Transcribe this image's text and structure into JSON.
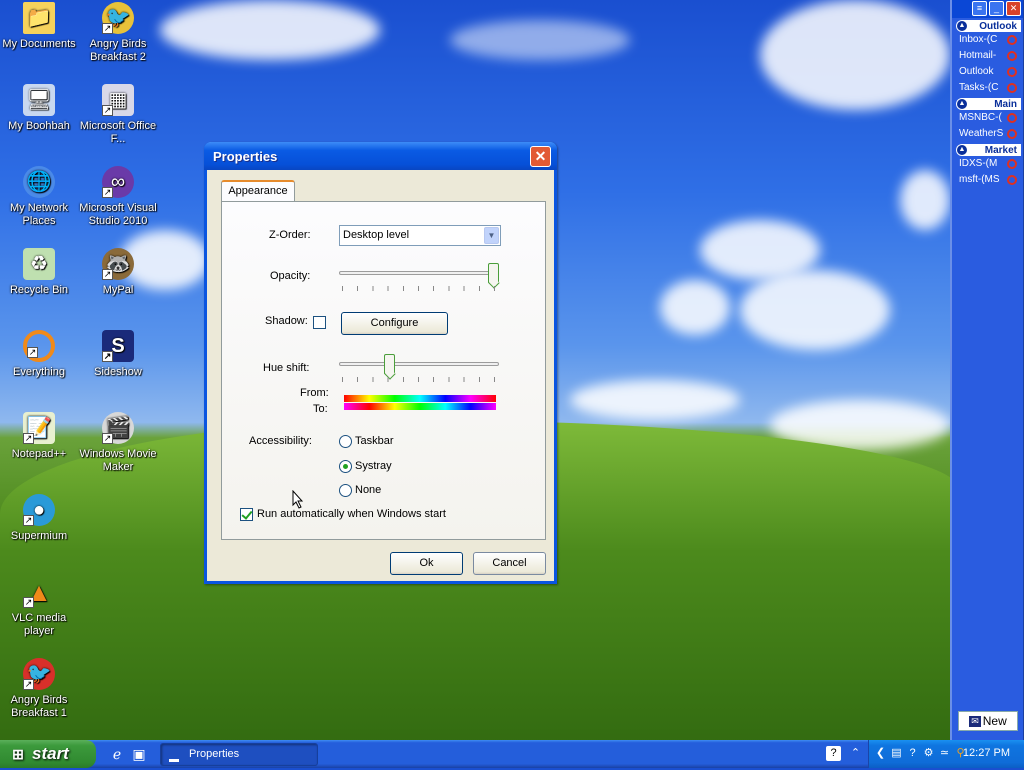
{
  "desktop": {
    "icons": [
      {
        "label": "My Documents",
        "icon": "folder-icon"
      },
      {
        "label": "Angry Birds Breakfast 2",
        "icon": "angry-birds-icon"
      },
      {
        "label": "My Boohbah",
        "icon": "computer-icon"
      },
      {
        "label": "Microsoft Office F...",
        "icon": "office-icon"
      },
      {
        "label": "My Network Places",
        "icon": "network-icon"
      },
      {
        "label": "Microsoft Visual Studio 2010",
        "icon": "visual-studio-icon"
      },
      {
        "label": "Recycle Bin",
        "icon": "recycle-bin-icon"
      },
      {
        "label": "MyPal",
        "icon": "mypal-icon"
      },
      {
        "label": "Everything",
        "icon": "everything-icon"
      },
      {
        "label": "Sideshow",
        "icon": "sideshow-icon"
      },
      {
        "label": "Notepad++",
        "icon": "notepad-icon"
      },
      {
        "label": "Windows Movie Maker",
        "icon": "movie-maker-icon"
      },
      {
        "label": "Supermium",
        "icon": "browser-icon"
      },
      {
        "label": "VLC media player",
        "icon": "vlc-icon"
      },
      {
        "label": "Angry Birds Breakfast 1",
        "icon": "angry-birds-icon"
      }
    ]
  },
  "sidebar": {
    "sections": [
      {
        "title": "Outlook",
        "items": [
          "Inbox-(C",
          "Hotmail-",
          "Outlook",
          "Tasks-(C"
        ]
      },
      {
        "title": "Main",
        "items": [
          "MSNBC-(",
          "WeatherS"
        ]
      },
      {
        "title": "Market",
        "items": [
          "IDXS-(M",
          "msft-(MS"
        ]
      }
    ],
    "new_label": "New"
  },
  "dialog": {
    "title": "Properties",
    "close_glyph": "✕",
    "tab": "Appearance",
    "zorder_label": "Z-Order:",
    "zorder_value": "Desktop level",
    "opacity_label": "Opacity:",
    "opacity_value": 1.0,
    "shadow_label": "Shadow:",
    "configure_label": "Configure",
    "hue_label": "Hue shift:",
    "hue_value": 0.3,
    "from_label": "From:",
    "to_label": "To:",
    "accessibility_label": "Accessibility:",
    "radio_taskbar": "Taskbar",
    "radio_systray": "Systray",
    "radio_none": "None",
    "run_auto_label": "Run automatically when Windows start",
    "ok_label": "Ok",
    "cancel_label": "Cancel"
  },
  "taskbar": {
    "start_label": "start",
    "task_label": "Properties",
    "clock": "12:27 PM"
  }
}
